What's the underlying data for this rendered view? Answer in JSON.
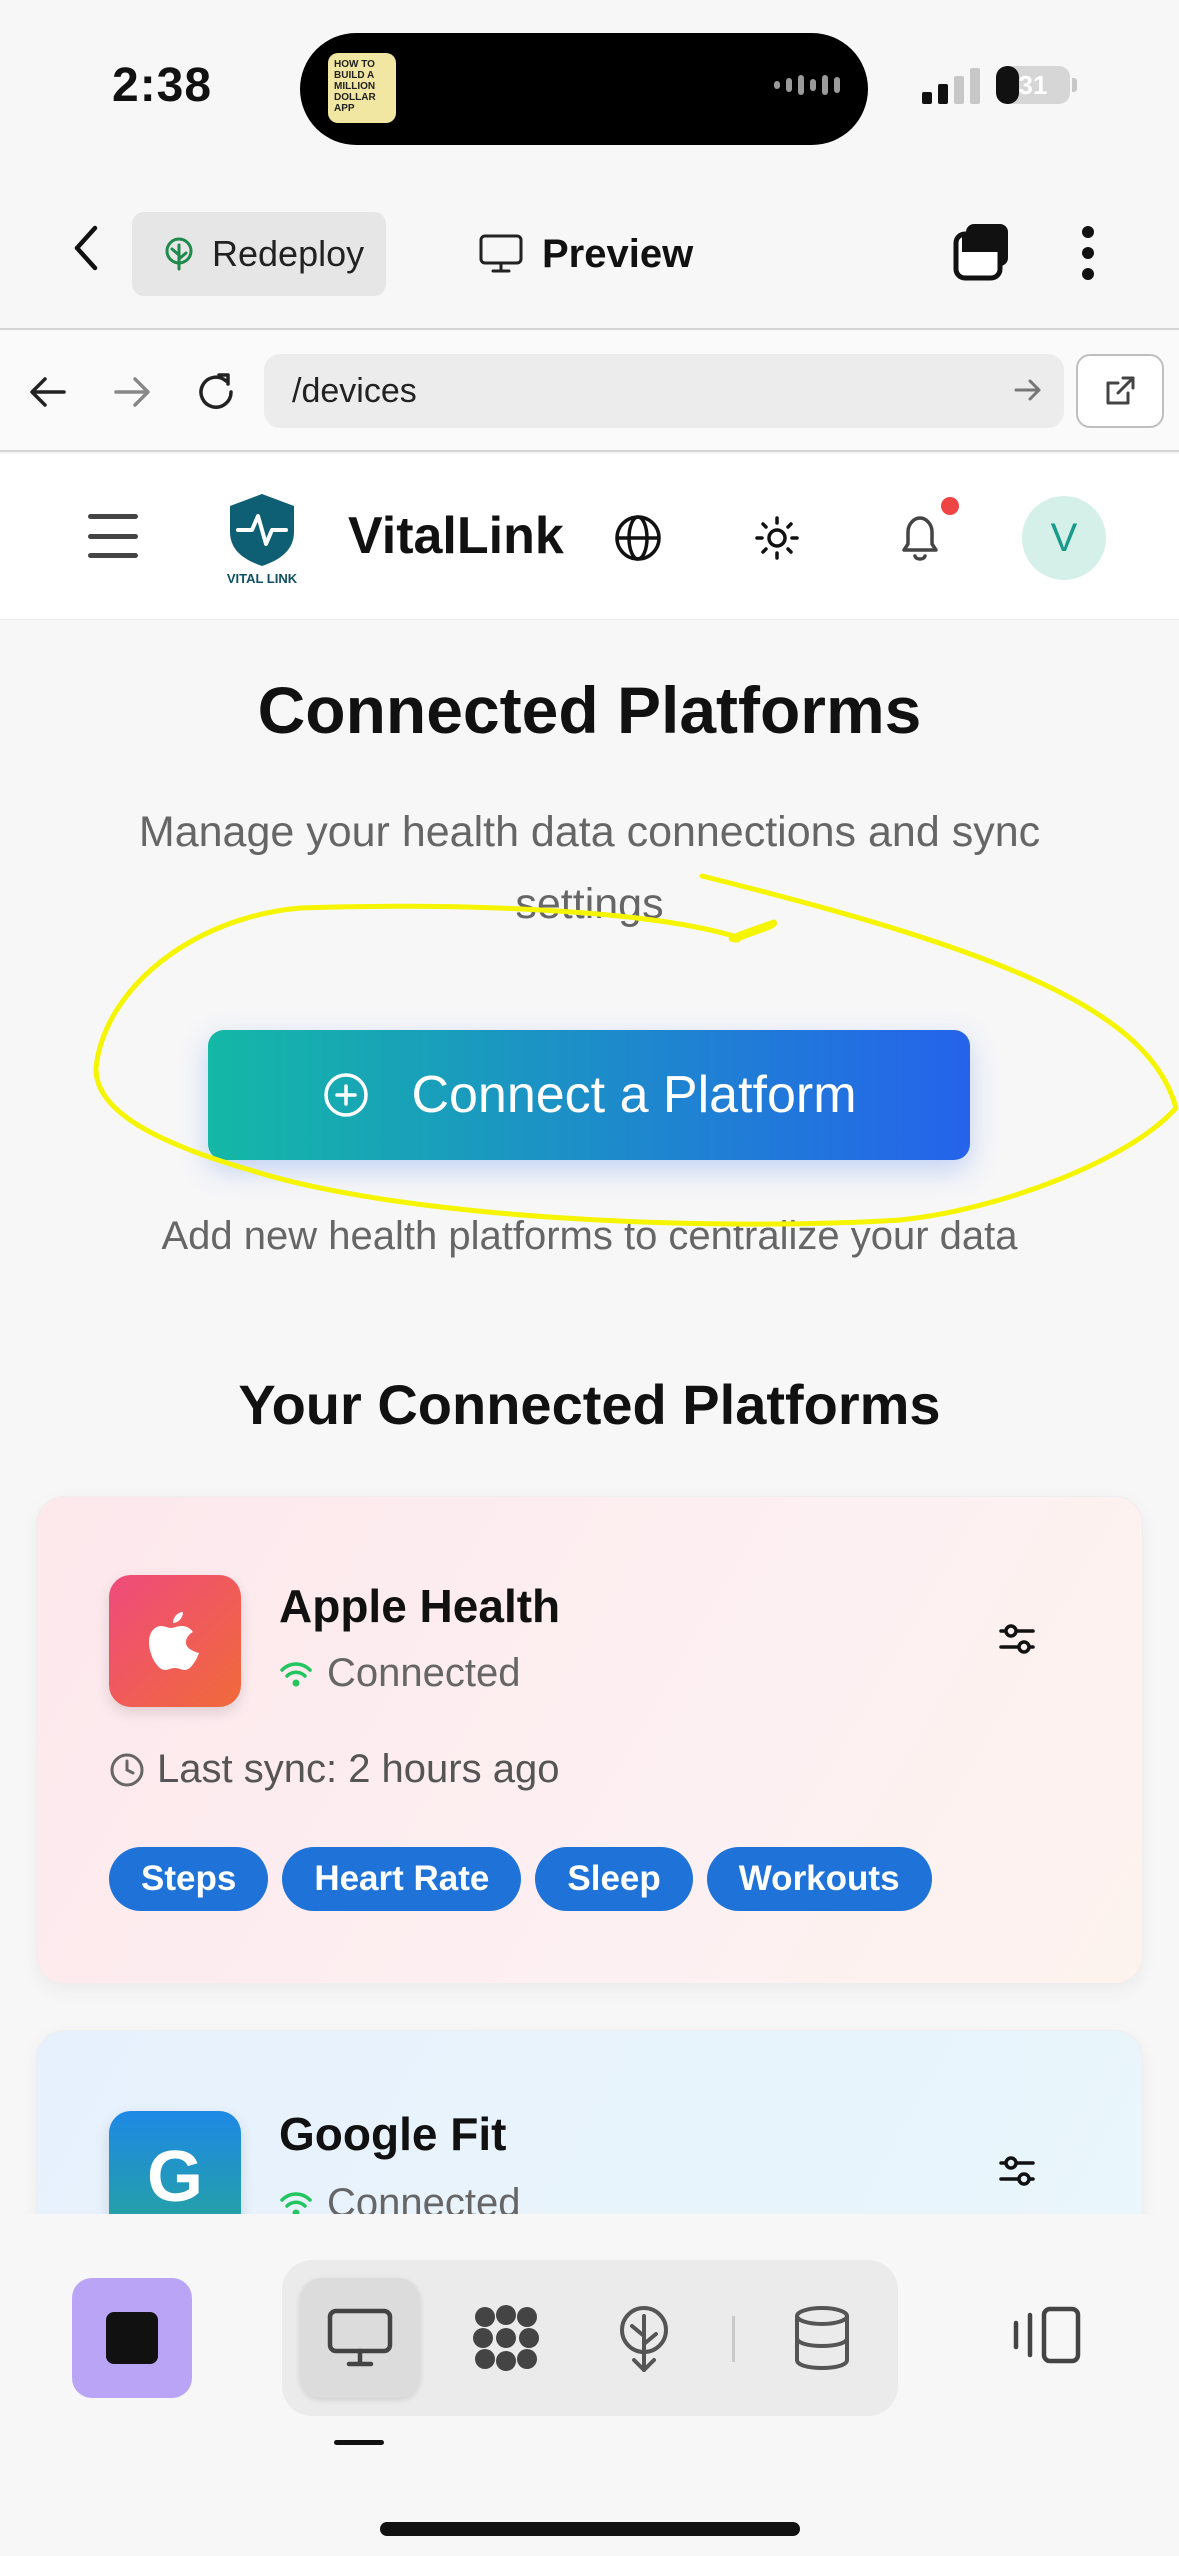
{
  "status_bar": {
    "time": "2:38",
    "battery": "31",
    "battery_level": 0.31,
    "island_thumb_text": "HOW TO BUILD A MILLION DOLLAR APP"
  },
  "toolbar": {
    "redeploy_label": "Redeploy",
    "preview_label": "Preview"
  },
  "browser": {
    "url": "/devices"
  },
  "site": {
    "brand": "VitalLink",
    "logo_text": "VITAL LINK",
    "avatar_initial": "V"
  },
  "page": {
    "title": "Connected Platforms",
    "subtitle": "Manage your health data connections and sync settings",
    "cta_label": "Connect a Platform",
    "cta_hint": "Add new health platforms to centralize your data",
    "section_title": "Your Connected Platforms"
  },
  "platforms": [
    {
      "name": "Apple Health",
      "status": "Connected",
      "last_sync": "Last sync: 2 hours ago",
      "tags": [
        "Steps",
        "Heart Rate",
        "Sleep",
        "Workouts"
      ]
    },
    {
      "name": "Google Fit",
      "icon_letter": "G",
      "status": "Connected"
    }
  ],
  "colors": {
    "accent_from": "#14b8a6",
    "accent_to": "#2563eb",
    "chip": "#1f73d8",
    "annotation": "#f5f500"
  }
}
